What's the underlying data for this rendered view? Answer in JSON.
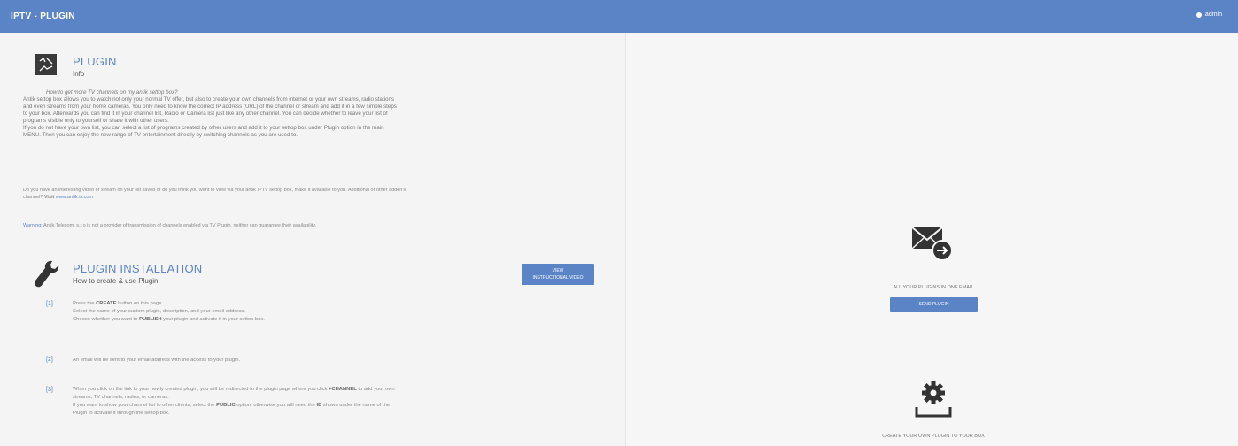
{
  "topbar": {
    "title": "IPTV - PLUGIN",
    "user": "admin"
  },
  "info": {
    "logo_text": "A\nCV",
    "title": "PLUGIN",
    "subtitle": "Info",
    "question": "How to get more TV channels on my antik settop box?",
    "body": [
      "Antik settop box allows you to watch not only your normal TV offer, but also to create your own channels from internet or your own streams, radio stations",
      "and even streams from your home cameras. You only need to know the correct IP address (URL) of the channel or stream and add it in a few simple steps",
      "to your box. Afterwards you can find it in your channel list, Radio or Camera list just like any other channel. You can decide whether to leave your list of",
      "programs visible only to yourself or share it with other users.",
      "If you do not have your own list, you can select a list of programs created by other users and add it to your settop box under Plugin option in the main",
      "MENU. Then you can enjoy the new range of TV entertainment directly by switching channels as you are used to."
    ],
    "extra": "Do you have an interesting video or stream on your list saved or do you think you want to view via your antik IPTV settop box, make it available to you. Additional or other addon's",
    "extra2": "channel?",
    "visit_label": "Visit",
    "visit_link": "www.antik.tv.com",
    "warning_label": "Warning:",
    "warning_text": "Antik Telecom, s.r.o is not a provider of transmission of channels enabled via TV Plugin, neither can guarantee their availability."
  },
  "install": {
    "title": "PLUGIN INSTALLATION",
    "subtitle": "How to create & use Plugin",
    "guide_button_line1": "VIEW",
    "guide_button_line2": "INSTRUCTIONAL VIDEO",
    "steps": [
      {
        "num": "[1]",
        "lines": [
          "Press the CREATE button on this page.",
          "Select the name of your custom plugin, description, and your email address.",
          "Choose whether you want to PUBLISH your plugin and activate it in your settop box."
        ]
      },
      {
        "num": "[2]",
        "lines": [
          "An email will be sent to your email address with the access to your plugin."
        ]
      },
      {
        "num": "[3]",
        "lines": [
          "When you click on the link to your newly created plugin, you will be redirected to the plugin page where you click +CHANNEL to add your own",
          "streams, TV channels, radios, or cameras.",
          "If you want to show your channel list to other clients, select the PUBLIC option, otherwise you will need the ID shown under the name of the",
          "Plugin to activate it through the settop box."
        ]
      }
    ]
  },
  "right": {
    "mail_label": "ALL YOUR PLUGINS IN ONE EMAIL",
    "mail_button": "SEND PLUGIN",
    "create_label": "CREATE YOUR OWN PLUGIN TO YOUR BOX"
  },
  "colors": {
    "accent": "#5a84c6",
    "dark": "#3a3a3a"
  }
}
